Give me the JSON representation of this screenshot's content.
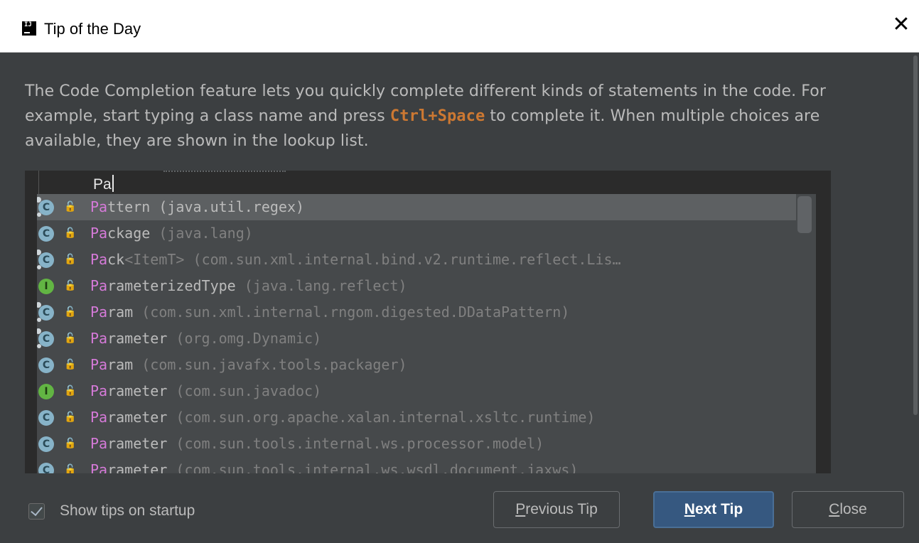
{
  "window": {
    "title": "Tip of the Day",
    "close_glyph": "✕"
  },
  "tip": {
    "text_before": "The Code Completion feature lets you quickly complete different kinds of statements in the code. For example, start typing a class name and press ",
    "shortcut": "Ctrl+Space",
    "text_after": " to complete it. When multiple choices are available, they are shown in the lookup list."
  },
  "editor": {
    "typed": "Pa"
  },
  "lookup": {
    "items": [
      {
        "icon": "class-abstract-icon",
        "match": "Pa",
        "rest": "ttern",
        "generic": "",
        "pkg": " (java.util.regex)",
        "bold": false,
        "pkg_highlight": true
      },
      {
        "icon": "class-icon",
        "match": "Pa",
        "rest": "ckage",
        "generic": "",
        "pkg": " (java.lang)",
        "bold": false,
        "pkg_highlight": false
      },
      {
        "icon": "class-abstract-icon",
        "match": "Pa",
        "rest": "ck",
        "generic": "<ItemT>",
        "pkg": " (com.sun.xml.internal.bind.v2.runtime.reflect.Lis…",
        "bold": false,
        "pkg_highlight": false
      },
      {
        "icon": "interface-icon",
        "match": "Pa",
        "rest": "rameterizedType",
        "generic": "",
        "pkg": " (java.lang.reflect)",
        "bold": false,
        "pkg_highlight": false
      },
      {
        "icon": "class-abstract-icon",
        "match": "Pa",
        "rest": "ram",
        "generic": "",
        "pkg": " (com.sun.xml.internal.rngom.digested.DDataPattern)",
        "bold": false,
        "pkg_highlight": false
      },
      {
        "icon": "class-abstract-icon",
        "match": "Pa",
        "rest": "rameter",
        "generic": "",
        "pkg": " (org.omg.Dynamic)",
        "bold": false,
        "pkg_highlight": false
      },
      {
        "icon": "class-icon",
        "match": "Pa",
        "rest": "ram",
        "generic": "",
        "pkg": " (com.sun.javafx.tools.packager)",
        "bold": false,
        "pkg_highlight": false
      },
      {
        "icon": "interface-icon",
        "match": "Pa",
        "rest": "rameter",
        "generic": "",
        "pkg": " (com.sun.javadoc)",
        "bold": false,
        "pkg_highlight": false
      },
      {
        "icon": "class-icon",
        "match": "Pa",
        "rest": "rameter",
        "generic": "",
        "pkg": " (com.sun.org.apache.xalan.internal.xsltc.runtime)",
        "bold": false,
        "pkg_highlight": false
      },
      {
        "icon": "class-icon",
        "match": "Pa",
        "rest": "rameter",
        "generic": "",
        "pkg": " (com.sun.tools.internal.ws.processor.model)",
        "bold": false,
        "pkg_highlight": false
      },
      {
        "icon": "class-icon",
        "match": "Pa",
        "rest": "rameter",
        "generic": "",
        "pkg": " (com.sun.tools.internal.ws.wsdl.document.jaxws)",
        "bold": false,
        "pkg_highlight": false
      }
    ]
  },
  "footer": {
    "show_tips_label": "Show tips on startup",
    "show_tips_checked": true,
    "prev_mnemonic": "P",
    "prev_rest": "revious Tip",
    "next_mnemonic": "N",
    "next_rest": "ext Tip",
    "close_mnemonic": "C",
    "close_rest": "lose"
  }
}
